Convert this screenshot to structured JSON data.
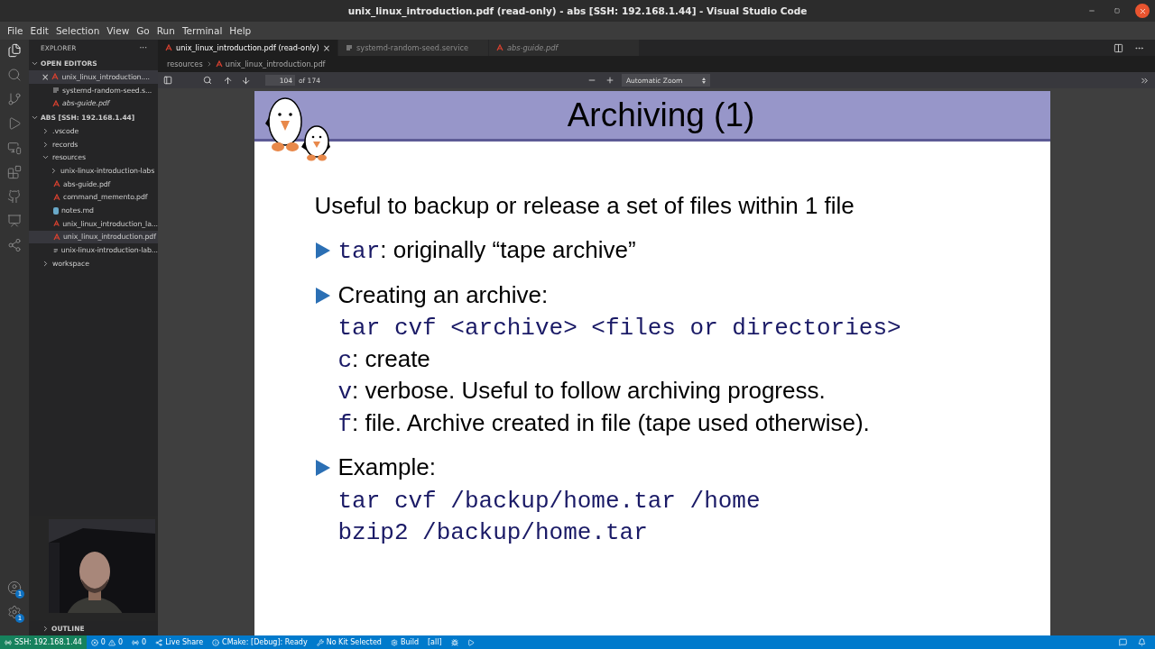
{
  "window": {
    "title": "unix_linux_introduction.pdf (read-only) - abs [SSH: 192.168.1.44] - Visual Studio Code"
  },
  "menu": [
    "File",
    "Edit",
    "Selection",
    "View",
    "Go",
    "Run",
    "Terminal",
    "Help"
  ],
  "activity_bar": {
    "badges": [
      "1",
      "1"
    ]
  },
  "sidebar": {
    "title": "EXPLORER",
    "more": "···",
    "open_editors": {
      "label": "OPEN EDITORS",
      "expanded": true,
      "items": [
        {
          "name": "unix_linux_introduction....",
          "kind": "pdf",
          "selected": true,
          "preview": false,
          "close": "×"
        },
        {
          "name": "systemd-random-seed.s...",
          "kind": "text",
          "selected": false,
          "preview": false
        },
        {
          "name": "abs-guide.pdf",
          "kind": "pdf",
          "selected": false,
          "preview": true
        }
      ]
    },
    "folder": {
      "label": "ABS [SSH: 192.168.1.44]",
      "expanded": true,
      "children": [
        {
          "name": ".vscode",
          "kind": "folder",
          "expanded": false,
          "selected": false
        },
        {
          "name": "records",
          "kind": "folder",
          "expanded": false,
          "selected": false
        },
        {
          "name": "resources",
          "kind": "folder",
          "expanded": true,
          "selected": false,
          "children": [
            {
              "name": "unix-linux-introduction-labs",
              "kind": "folder",
              "expanded": false,
              "selected": false
            },
            {
              "name": "abs-guide.pdf",
              "kind": "pdf",
              "selected": false
            },
            {
              "name": "command_memento.pdf",
              "kind": "pdf",
              "selected": false
            },
            {
              "name": "notes.md",
              "kind": "markdown",
              "selected": false
            },
            {
              "name": "unix_linux_introduction_la...",
              "kind": "pdf",
              "selected": false
            },
            {
              "name": "unix_linux_introduction.pdf",
              "kind": "pdf",
              "selected": true
            },
            {
              "name": "unix-linux-introduction-lab...",
              "kind": "text",
              "selected": false
            }
          ]
        },
        {
          "name": "workspace",
          "kind": "folder",
          "expanded": false,
          "selected": false
        }
      ]
    },
    "outline": {
      "label": "OUTLINE",
      "expanded": false
    }
  },
  "tabs": [
    {
      "label": "unix_linux_introduction.pdf (read-only)",
      "kind": "pdf",
      "selected": true,
      "preview": false,
      "close": "×"
    },
    {
      "label": "systemd-random-seed.service",
      "kind": "text",
      "selected": false,
      "preview": false
    },
    {
      "label": "abs-guide.pdf",
      "kind": "pdf",
      "selected": false,
      "preview": true
    }
  ],
  "breadcrumbs": [
    "resources",
    "unix_linux_introduction.pdf"
  ],
  "pdf_toolbar": {
    "page": "104",
    "page_count": "of 174",
    "zoom": "Automatic Zoom"
  },
  "slide": {
    "title": "Archiving (1)",
    "intro": "Useful to backup or release a set of files within 1 file",
    "bullets": [
      {
        "lines": [
          {
            "code": "tar",
            "text": ": originally “tape archive”"
          }
        ]
      },
      {
        "lines": [
          {
            "text": "Creating an archive:"
          },
          {
            "code": "tar cvf <archive> <files or directories>"
          },
          {
            "code": "c",
            "text": ": create"
          },
          {
            "code": "v",
            "text": ": verbose. Useful to follow archiving progress."
          },
          {
            "code": "f",
            "text": ": file. Archive created in file (tape used otherwise)."
          }
        ]
      },
      {
        "lines": [
          {
            "text": "Example:"
          },
          {
            "code": "tar cvf /backup/home.tar /home"
          },
          {
            "code": "bzip2 /backup/home.tar"
          }
        ]
      }
    ]
  },
  "status_bar": {
    "items": [
      {
        "kind": "remote",
        "text": "SSH: 192.168.1.44"
      },
      {
        "kind": "problems",
        "text": "0",
        "warnings": "0"
      },
      {
        "kind": "ports",
        "text": "0"
      },
      {
        "kind": "liveshare",
        "text": "Live Share"
      },
      {
        "kind": "cmake",
        "text": "CMake: [Debug]: Ready"
      },
      {
        "kind": "kit",
        "text": "No Kit Selected"
      },
      {
        "kind": "build",
        "text": "Build"
      },
      {
        "kind": "plain",
        "text": "[all]"
      },
      {
        "kind": "debug"
      },
      {
        "kind": "run"
      }
    ]
  }
}
